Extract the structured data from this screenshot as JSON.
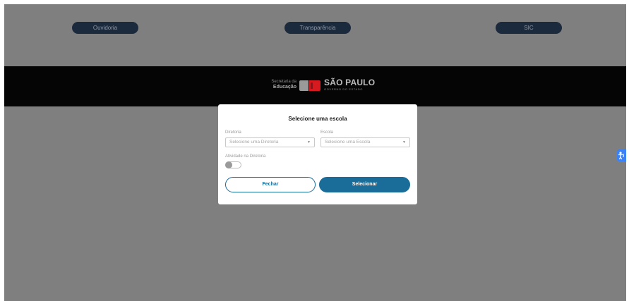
{
  "top_links": {
    "ouvidoria": "Ouvidoria",
    "transparencia": "Transparência",
    "sic": "SIC"
  },
  "brand": {
    "secretaria_line1": "Secretaria da",
    "secretaria_line2": "Educação",
    "sao_paulo": "SÃO PAULO",
    "governo": "GOVERNO DO ESTADO",
    "colors": {
      "flag_red": "#d71920",
      "mark_gray": "#9a9a9a"
    }
  },
  "modal": {
    "title": "Selecione uma escola",
    "diretoria": {
      "label": "Diretoria",
      "placeholder": "Selecione uma Diretoria"
    },
    "escola": {
      "label": "Escola",
      "placeholder": "Selecione uma Escola"
    },
    "toggle": {
      "label": "Atividade na Diretoria",
      "on": false
    },
    "close_label": "Fechar",
    "select_label": "Selecionar"
  },
  "colors": {
    "overlay": "#7f7f7f",
    "nav_pill": "#1c2a3e",
    "brand_bar": "#050505",
    "primary": "#1a6c99",
    "accessibility": "#3b82f6"
  },
  "icons": {
    "select_caret": "caret-down-icon",
    "accessibility": "accessibility-icon"
  }
}
